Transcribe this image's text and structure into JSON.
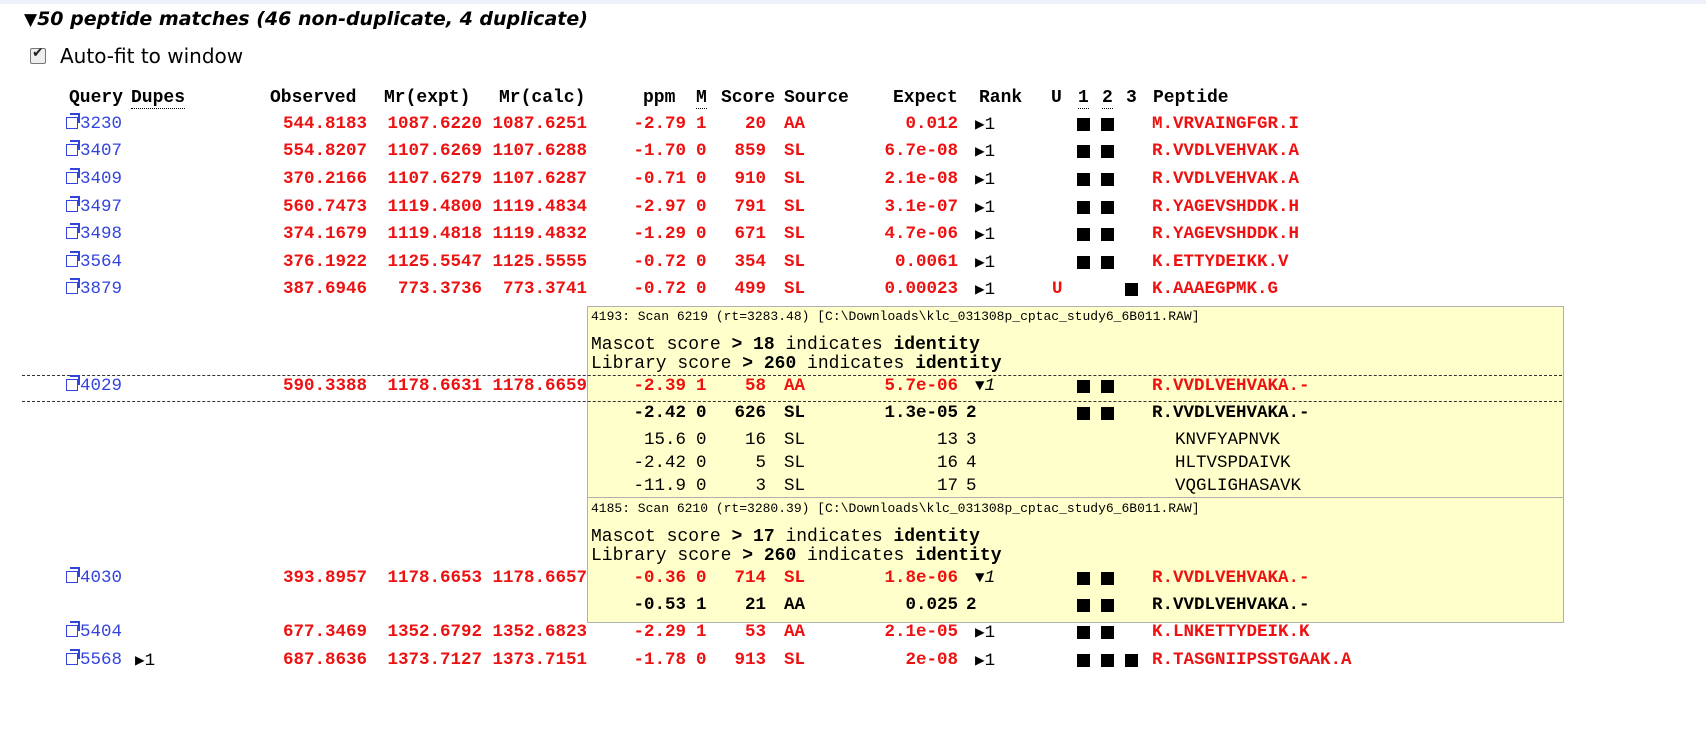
{
  "summary": {
    "arrow": "▼",
    "text": "50 peptide matches (46 non-duplicate, 4 duplicate)"
  },
  "autofit": {
    "label": "Auto-fit to window",
    "checked": true
  },
  "headers": {
    "query": "Query",
    "dupes": "Dupes",
    "observed": "Observed",
    "mr_expt": "Mr(expt)",
    "mr_calc": "Mr(calc)",
    "ppm": "ppm",
    "m": "M",
    "score": "Score",
    "source": "Source",
    "expect": "Expect",
    "rank": "Rank",
    "u": "U",
    "c1": "1",
    "c2": "2",
    "c3": "3",
    "peptide": "Peptide"
  },
  "rows": [
    {
      "query": "3230",
      "observed": "544.8183",
      "mr_expt": "1087.6220",
      "mr_calc": "1087.6251",
      "ppm": "-2.79",
      "m": "1",
      "score": "20",
      "source": "AA",
      "expect": "0.012",
      "rank": "1",
      "peptide": "M.VRVAINGFGR.I"
    },
    {
      "query": "3407",
      "observed": "554.8207",
      "mr_expt": "1107.6269",
      "mr_calc": "1107.6288",
      "ppm": "-1.70",
      "m": "0",
      "score": "859",
      "source": "SL",
      "expect": "6.7e-08",
      "rank": "1",
      "peptide": "R.VVDLVEHVAK.A"
    },
    {
      "query": "3409",
      "observed": "370.2166",
      "mr_expt": "1107.6279",
      "mr_calc": "1107.6287",
      "ppm": "-0.71",
      "m": "0",
      "score": "910",
      "source": "SL",
      "expect": "2.1e-08",
      "rank": "1",
      "peptide": "R.VVDLVEHVAK.A"
    },
    {
      "query": "3497",
      "observed": "560.7473",
      "mr_expt": "1119.4800",
      "mr_calc": "1119.4834",
      "ppm": "-2.97",
      "m": "0",
      "score": "791",
      "source": "SL",
      "expect": "3.1e-07",
      "rank": "1",
      "peptide": "R.YAGEVSHDDK.H"
    },
    {
      "query": "3498",
      "observed": "374.1679",
      "mr_expt": "1119.4818",
      "mr_calc": "1119.4832",
      "ppm": "-1.29",
      "m": "0",
      "score": "671",
      "source": "SL",
      "expect": "4.7e-06",
      "rank": "1",
      "peptide": "R.YAGEVSHDDK.H"
    },
    {
      "query": "3564",
      "observed": "376.1922",
      "mr_expt": "1125.5547",
      "mr_calc": "1125.5555",
      "ppm": "-0.72",
      "m": "0",
      "score": "354",
      "source": "SL",
      "expect": "0.0061",
      "rank": "1",
      "peptide": "K.ETTYDEIKK.V"
    },
    {
      "query": "3879",
      "observed": "387.6946",
      "mr_expt": "773.3736",
      "mr_calc": "773.3741",
      "ppm": "-0.72",
      "m": "0",
      "score": "499",
      "source": "SL",
      "expect": "0.00023",
      "rank": "1",
      "u": "U",
      "peptide": "K.AAAEGPMK.G"
    }
  ],
  "popup1": {
    "scan": "4193: Scan 6219 (rt=3283.48) [C:\\Downloads\\klc_031308p_cptac_study6_6B011.RAW]",
    "mascot": {
      "pre": "Mascot score ",
      "gt": "> 18",
      "mid": " indicates ",
      "word": "identity"
    },
    "library": {
      "pre": "Library score ",
      "gt": "> 260",
      "mid": " indicates ",
      "word": "identity"
    },
    "row": {
      "query": "4029",
      "observed": "590.3388",
      "mr_expt": "1178.6631",
      "mr_calc": "1178.6659",
      "ppm": "-2.39",
      "m": "1",
      "score": "58",
      "source": "AA",
      "expect": "5.7e-06",
      "rank": "1",
      "peptide": "R.VVDLVEHVAKA.-"
    },
    "subrows": [
      {
        "ppm": "-2.42",
        "m": "0",
        "score": "626",
        "source": "SL",
        "expect": "1.3e-05",
        "rank": "2",
        "peptide": "R.VVDLVEHVAKA.-"
      },
      {
        "ppm": "15.6",
        "m": "0",
        "score": "16",
        "source": "SL",
        "expect": "13",
        "rank": "3",
        "peptide": "KNVFYAPNVK"
      },
      {
        "ppm": "-2.42",
        "m": "0",
        "score": "5",
        "source": "SL",
        "expect": "16",
        "rank": "4",
        "peptide": "HLTVSPDAIVK"
      },
      {
        "ppm": "-11.9",
        "m": "0",
        "score": "3",
        "source": "SL",
        "expect": "17",
        "rank": "5",
        "peptide": "VQGLIGHASAVK"
      }
    ]
  },
  "popup2": {
    "scan": "4185: Scan 6210 (rt=3280.39) [C:\\Downloads\\klc_031308p_cptac_study6_6B011.RAW]",
    "mascot": {
      "pre": "Mascot score ",
      "gt": "> 17",
      "mid": " indicates ",
      "word": "identity"
    },
    "library": {
      "pre": "Library score ",
      "gt": "> 260",
      "mid": " indicates ",
      "word": "identity"
    },
    "row": {
      "query": "4030",
      "observed": "393.8957",
      "mr_expt": "1178.6653",
      "mr_calc": "1178.6657",
      "ppm": "-0.36",
      "m": "0",
      "score": "714",
      "source": "SL",
      "expect": "1.8e-06",
      "rank": "1",
      "peptide": "R.VVDLVEHVAKA.-"
    },
    "subrows": [
      {
        "ppm": "-0.53",
        "m": "1",
        "score": "21",
        "source": "AA",
        "expect": "0.025",
        "rank": "2",
        "peptide": "R.VVDLVEHVAKA.-"
      }
    ]
  },
  "rows_after": [
    {
      "query": "5404",
      "observed": "677.3469",
      "mr_expt": "1352.6792",
      "mr_calc": "1352.6823",
      "ppm": "-2.29",
      "m": "1",
      "score": "53",
      "source": "AA",
      "expect": "2.1e-05",
      "rank": "1",
      "peptide": "K.LNKETTYDEIK.K"
    },
    {
      "query": "5568",
      "dupes": "1",
      "observed": "687.8636",
      "mr_expt": "1373.7127",
      "mr_calc": "1373.7151",
      "ppm": "-1.78",
      "m": "0",
      "score": "913",
      "source": "SL",
      "expect": "2e-08",
      "rank": "1",
      "peptide": "R.TASGNIIPSSTGAAK.A"
    }
  ]
}
